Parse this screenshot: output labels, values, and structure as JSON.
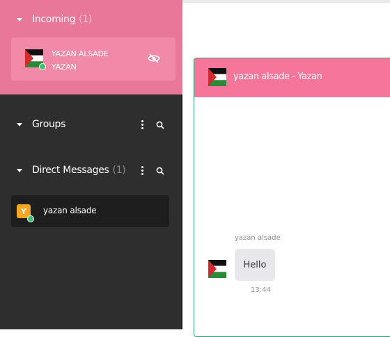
{
  "incoming": {
    "title": "Incoming",
    "count": "(1)",
    "item": {
      "line1": "YAZAN ALSADE",
      "line2": "YAZAN"
    }
  },
  "groups": {
    "title": "Groups"
  },
  "direct_messages": {
    "title": "Direct Messages",
    "count": "(1)",
    "items": [
      {
        "avatar_letter": "Y",
        "name": "yazan alsade"
      }
    ]
  },
  "chat": {
    "title": "yazan alsade - Yazan",
    "messages": [
      {
        "sender": "yazan alsade",
        "text": "Hello",
        "time": "13:44"
      }
    ]
  },
  "icons": {
    "flag": "palestine-flag-icon",
    "visibility": "eye-off-icon",
    "menu": "kebab-menu-icon",
    "search": "search-icon"
  },
  "colors": {
    "incoming_bg": "#e8779a",
    "chat_header": "#f6769b",
    "sidebar_bg": "#2e2e2e",
    "online": "#3cc06a",
    "avatar": "#f5a623",
    "chat_border": "#2f9e6d"
  }
}
